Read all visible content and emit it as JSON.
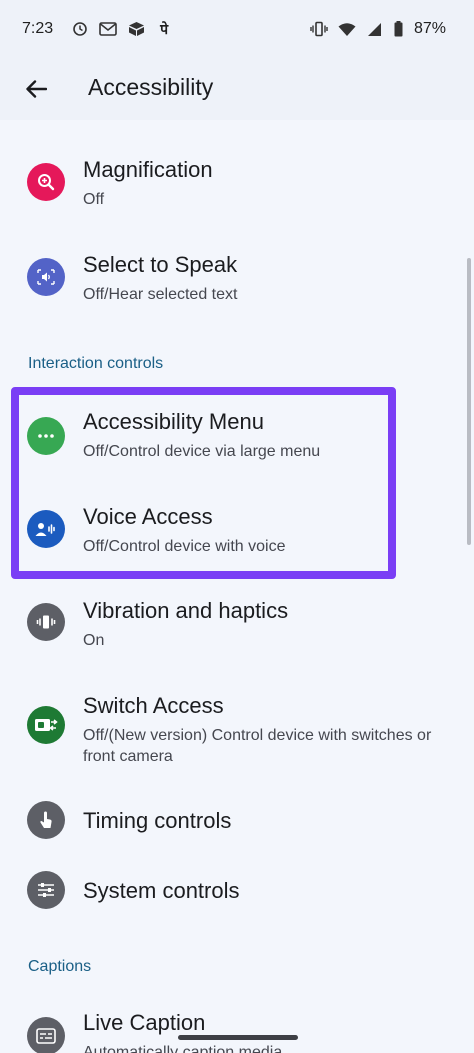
{
  "status_bar": {
    "time": "7:23",
    "left_icons": [
      "clock-sync-icon",
      "mail-icon",
      "package-icon",
      "hindi-char-icon"
    ],
    "hindi_char": "पे",
    "right_icons": [
      "vibrate-icon",
      "wifi-icon",
      "signal-icon",
      "battery-icon"
    ],
    "battery": "87%"
  },
  "app_bar": {
    "title": "Accessibility"
  },
  "sections": {
    "interaction_controls": "Interaction controls",
    "captions": "Captions"
  },
  "items": {
    "magnification": {
      "title": "Magnification",
      "sub": "Off",
      "icon": "magnify-icon",
      "color": "#e5185a"
    },
    "select_to_speak": {
      "title": "Select to Speak",
      "sub": "Off/Hear selected text",
      "icon": "speaker-icon",
      "color": "#5363c7"
    },
    "accessibility_menu": {
      "title": "Accessibility Menu",
      "sub": "Off/Control device via large menu",
      "icon": "menu-dots-icon",
      "color": "#37a853"
    },
    "voice_access": {
      "title": "Voice Access",
      "sub": "Off/Control device with voice",
      "icon": "voice-icon",
      "color": "#1b5bbf"
    },
    "vibration": {
      "title": "Vibration and haptics",
      "sub": "On",
      "icon": "vibrate-icon",
      "color": "#5d5f66"
    },
    "switch_access": {
      "title": "Switch Access",
      "sub": "Off/(New version) Control device with switches or front camera",
      "icon": "switch-icon",
      "color": "#1e7a34"
    },
    "timing": {
      "title": "Timing controls",
      "icon": "touch-icon",
      "color": "#5d5f66"
    },
    "system": {
      "title": "System controls",
      "icon": "sliders-icon",
      "color": "#5d5f66"
    },
    "live_caption": {
      "title": "Live Caption",
      "sub": "Automatically caption media",
      "icon": "caption-icon",
      "color": "#5d5f66"
    }
  },
  "colors": {
    "highlight": "#7a3ef5",
    "section_header": "#1a5f86",
    "background": "#f3f6fc"
  }
}
